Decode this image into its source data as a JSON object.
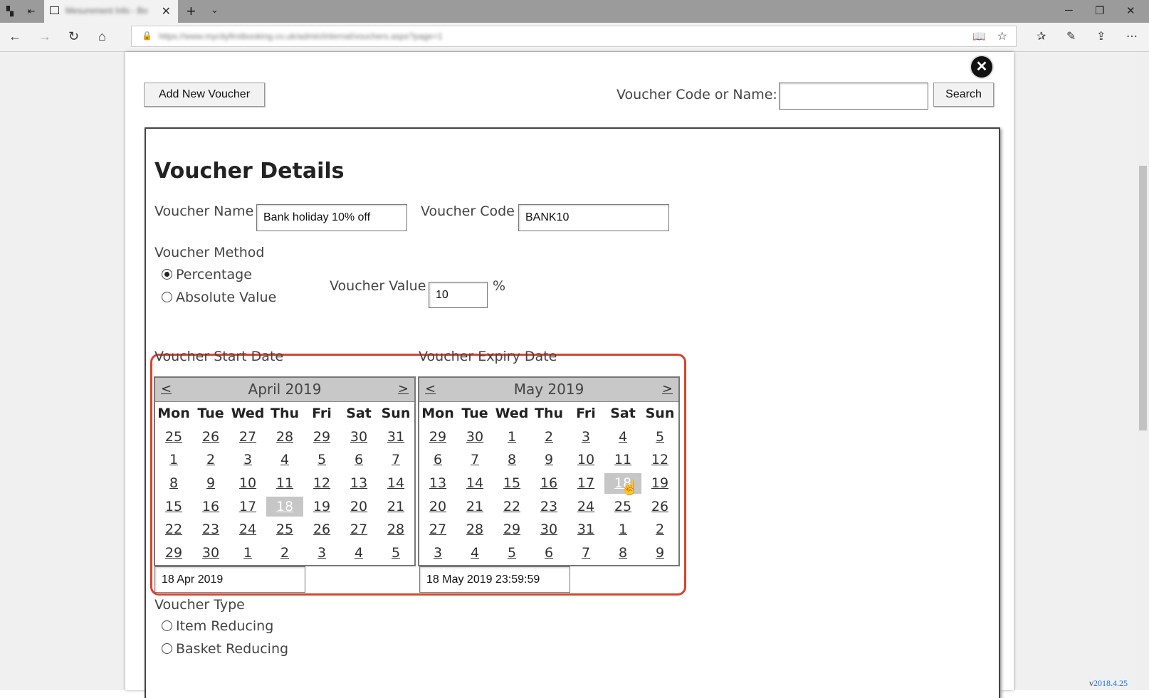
{
  "browser": {
    "tab_title": "Mesurement Info - Bo",
    "url": "https://www.mycityfirstbooking.co.uk/admin/internal/vouchers.aspx?page=1"
  },
  "toolbar": {
    "add_voucher_label": "Add New Voucher",
    "search_label": "Voucher Code or Name:",
    "search_value": "",
    "search_button": "Search"
  },
  "details": {
    "heading": "Voucher Details",
    "name_label": "Voucher Name",
    "name_value": "Bank holiday 10% off",
    "code_label": "Voucher Code",
    "code_value": "BANK10",
    "method_label": "Voucher Method",
    "method_options": [
      "Percentage",
      "Absolute Value"
    ],
    "method_selected": "Percentage",
    "value_label": "Voucher Value",
    "value_value": "10",
    "value_unit": "%",
    "start_label": "Voucher Start Date",
    "expiry_label": "Voucher Expiry Date",
    "start_field": "18 Apr 2019",
    "expiry_field": "18 May 2019 23:59:59",
    "type_label": "Voucher Type",
    "type_options": [
      "Item Reducing",
      "Basket Reducing"
    ]
  },
  "calendars": [
    {
      "month": "April 2019",
      "prev": "<",
      "next": ">",
      "days_of_week": [
        "Mon",
        "Tue",
        "Wed",
        "Thu",
        "Fri",
        "Sat",
        "Sun"
      ],
      "weeks": [
        [
          "25",
          "26",
          "27",
          "28",
          "29",
          "30",
          "31"
        ],
        [
          "1",
          "2",
          "3",
          "4",
          "5",
          "6",
          "7"
        ],
        [
          "8",
          "9",
          "10",
          "11",
          "12",
          "13",
          "14"
        ],
        [
          "15",
          "16",
          "17",
          "18",
          "19",
          "20",
          "21"
        ],
        [
          "22",
          "23",
          "24",
          "25",
          "26",
          "27",
          "28"
        ],
        [
          "29",
          "30",
          "1",
          "2",
          "3",
          "4",
          "5"
        ]
      ],
      "selected": [
        3,
        3
      ]
    },
    {
      "month": "May 2019",
      "prev": "<",
      "next": ">",
      "days_of_week": [
        "Mon",
        "Tue",
        "Wed",
        "Thu",
        "Fri",
        "Sat",
        "Sun"
      ],
      "weeks": [
        [
          "29",
          "30",
          "1",
          "2",
          "3",
          "4",
          "5"
        ],
        [
          "6",
          "7",
          "8",
          "9",
          "10",
          "11",
          "12"
        ],
        [
          "13",
          "14",
          "15",
          "16",
          "17",
          "18",
          "19"
        ],
        [
          "20",
          "21",
          "22",
          "23",
          "24",
          "25",
          "26"
        ],
        [
          "27",
          "28",
          "29",
          "30",
          "31",
          "1",
          "2"
        ],
        [
          "3",
          "4",
          "5",
          "6",
          "7",
          "8",
          "9"
        ]
      ],
      "selected": [
        2,
        5
      ]
    }
  ],
  "footer": {
    "version_prefix": "v",
    "version": "2018.4.25"
  }
}
